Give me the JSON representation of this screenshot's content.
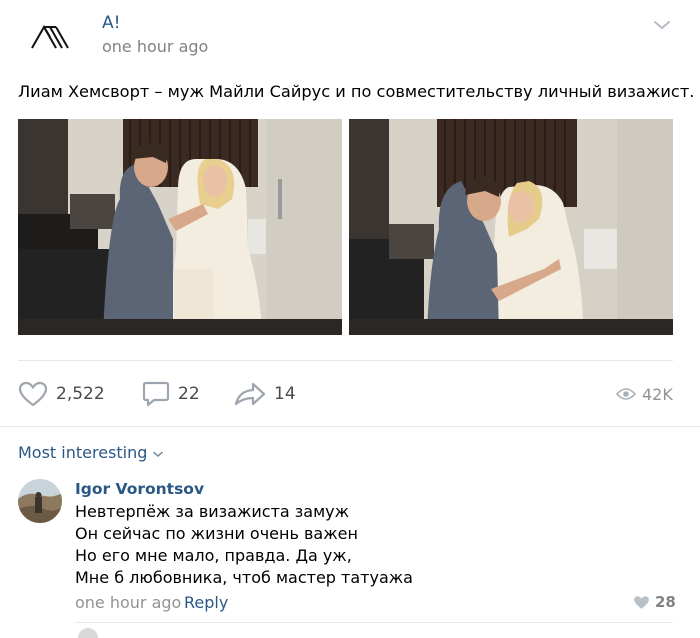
{
  "post": {
    "author": "A!",
    "time": "one hour ago",
    "text": "Лиам Хемсворт – муж Майли Сайрус и по совместительству личный визажист."
  },
  "icons": {
    "logo": "brand-logo-icon",
    "menu": "chevron-down-icon",
    "like": "heart-icon",
    "comment": "comment-bubble-icon",
    "share": "share-arrow-icon",
    "views": "eye-icon",
    "sort": "chevron-down-icon",
    "comment_like": "heart-filled-icon"
  },
  "actions": {
    "likes": "2,522",
    "comments": "22",
    "shares": "14",
    "views": "42K"
  },
  "comments_section": {
    "sort_label": "Most interesting"
  },
  "comment": {
    "author": "Igor Vorontsov",
    "lines": [
      "Невтерпёж за визажиста замуж",
      "Он сейчас по жизни очень важен",
      "Но его мне мало, правда. Да уж,",
      "Мне б любовника, чтоб мастер татуажа"
    ],
    "time": "one hour ago",
    "reply_label": "Reply",
    "likes": "28"
  },
  "colors": {
    "link": "#2a5885",
    "muted": "#828282",
    "icon": "#9da5ae",
    "divider": "#e7e8ec"
  }
}
